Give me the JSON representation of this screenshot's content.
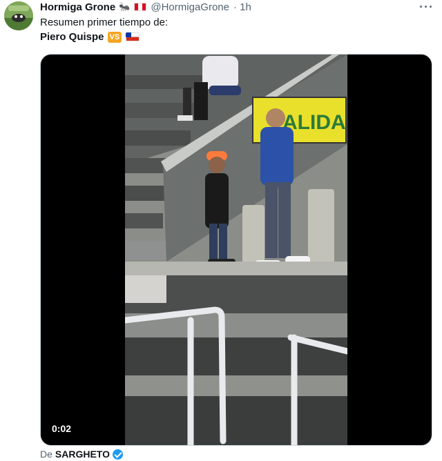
{
  "tweet": {
    "author_name": "Hormiga Grone",
    "author_emoji": "🐜",
    "handle": "@HormigaGrone",
    "time": "· 1h",
    "more_icon": "···",
    "text_line1": "Resumen primer tiempo de:",
    "text_line2": "Piero Quispe",
    "vs_badge": "VS"
  },
  "media": {
    "duration": "0:02",
    "sign_text": "ALIDA"
  },
  "credit": {
    "prefix": "De",
    "source": "SARGHETO"
  },
  "colors": {
    "accent": "#1d9bf0",
    "secondary_text": "#536471",
    "video_bg": "#000000",
    "sign_yellow": "#e8e02a"
  }
}
